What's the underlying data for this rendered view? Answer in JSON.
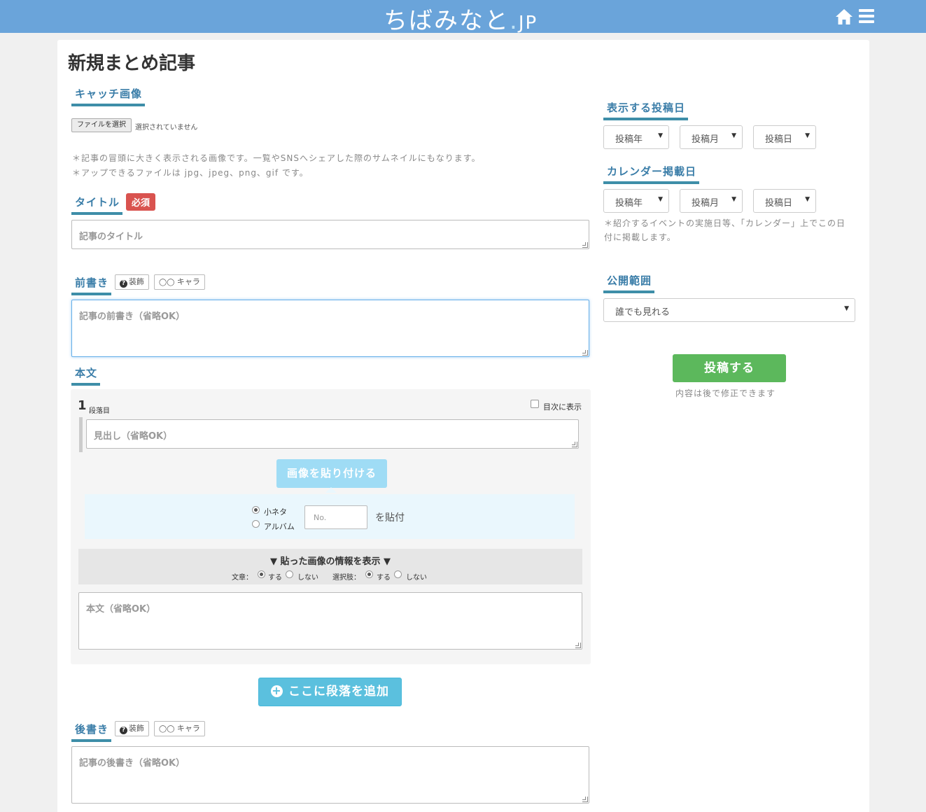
{
  "header": {
    "logo_main": "ちばみなと",
    "logo_dot": ".",
    "logo_jp": "JP"
  },
  "page": {
    "title": "新規まとめ記事"
  },
  "catch_image": {
    "label": "キャッチ画像",
    "file_button": "ファイルを選択",
    "file_status": "選択されていません",
    "note1": "＊記事の冒頭に大きく表示される画像です。一覧やSNSへシェアした際のサムネイルにもなります。",
    "note2": "＊アップできるファイルは jpg、jpeg、png、gif です。"
  },
  "title_field": {
    "label": "タイトル",
    "required": "必須",
    "placeholder": "記事のタイトル"
  },
  "intro": {
    "label": "前書き",
    "deco_btn": "装飾",
    "chara_btn": "キャラ",
    "placeholder": "記事の前書き（省略OK）"
  },
  "body": {
    "label": "本文",
    "paragraph_num": "1",
    "paragraph_unit": "段落目",
    "toc_label": "目次に表示",
    "heading_placeholder": "見出し（省略OK）",
    "paste_button": "画像を貼り付ける",
    "radio_small": "小ネタ",
    "radio_album": "アルバム",
    "no_placeholder": "No.",
    "paste_suffix": "を貼付",
    "info_title": "▼ 貼った画像の情報を表示 ▼",
    "text_label": "文章：",
    "choice_label": "選択肢：",
    "yes": "する",
    "no": "しない",
    "text_placeholder": "本文（省略OK）",
    "add_button": "ここに段落を追加"
  },
  "outro": {
    "label": "後書き",
    "deco_btn": "装飾",
    "chara_btn": "キャラ",
    "placeholder": "記事の後書き（省略OK）"
  },
  "sidebar": {
    "post_date_label": "表示する投稿日",
    "calendar_label": "カレンダー掲載日",
    "year": "投稿年",
    "month": "投稿月",
    "day": "投稿日",
    "calendar_note": "＊紹介するイベントの実施日等、「カレンダー」上でこの日付に掲載します。",
    "visibility_label": "公開範囲",
    "visibility_value": "誰でも見れる",
    "submit_button": "投稿する",
    "submit_note": "内容は後で修正できます"
  },
  "colors": {
    "header": "#6aa4da",
    "accent": "#3e8ea8",
    "required": "#d9534f",
    "submit": "#5cb85c",
    "add": "#5bc0de"
  }
}
